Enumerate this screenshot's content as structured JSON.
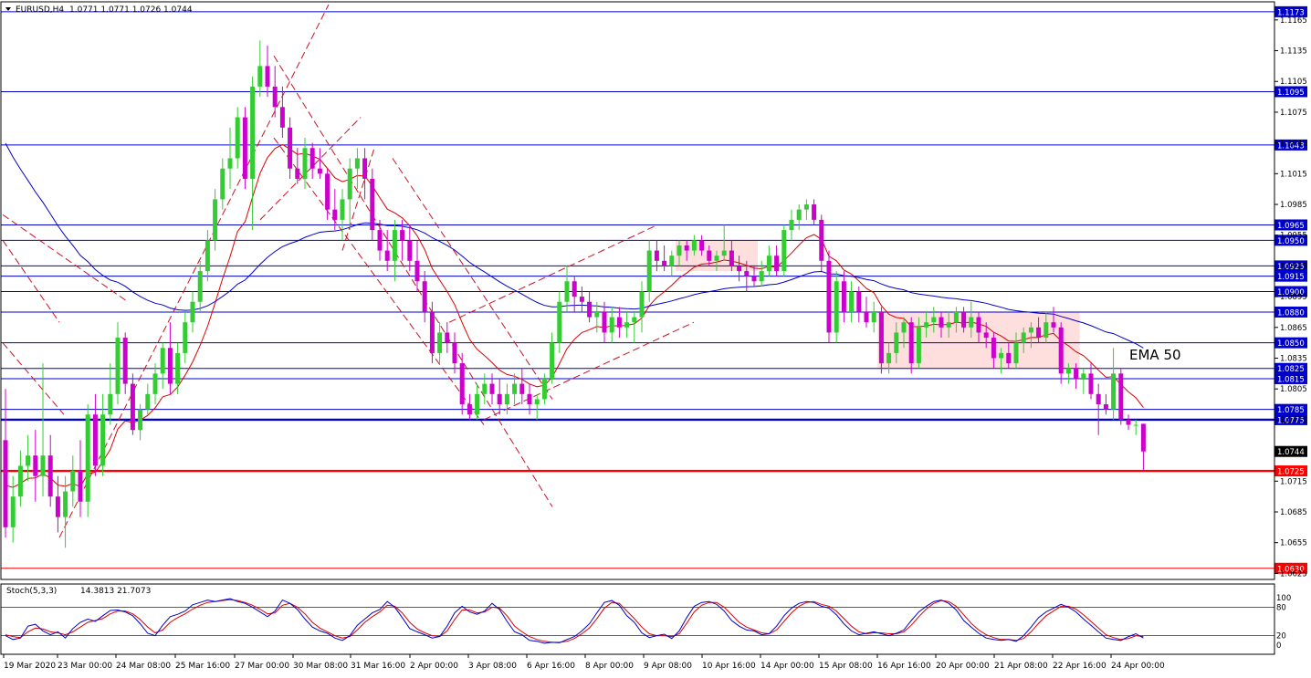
{
  "chart_data": {
    "type": "candlestick",
    "title": "EURUSD,H4",
    "ohlc_header": "1.0771 1.0771 1.0726 1.0744",
    "ylim": [
      1.062,
      1.118
    ],
    "y_ticks": [
      "1.1165",
      "1.1135",
      "1.1105",
      "1.1075",
      "1.1045",
      "1.1015",
      "1.0985",
      "1.0955",
      "1.0925",
      "1.0895",
      "1.0865",
      "1.0835",
      "1.0805",
      "1.0775",
      "1.0745",
      "1.0715",
      "1.0685",
      "1.0655",
      "1.0625"
    ],
    "x_ticks": [
      "19 Mar 2020",
      "23 Mar 00:00",
      "24 Mar 08:00",
      "25 Mar 16:00",
      "27 Mar 00:00",
      "30 Mar 08:00",
      "31 Mar 16:00",
      "2 Apr 00:00",
      "3 Apr 08:00",
      "6 Apr 16:00",
      "8 Apr 00:00",
      "9 Apr 08:00",
      "10 Apr 16:00",
      "14 Apr 00:00",
      "15 Apr 08:00",
      "16 Apr 16:00",
      "20 Apr 00:00",
      "21 Apr 08:00",
      "22 Apr 16:00",
      "24 Apr 00:00"
    ],
    "horizontal_levels": [
      {
        "price": "1.1173",
        "color": "#0000cc"
      },
      {
        "price": "1.1095",
        "color": "#0000cc"
      },
      {
        "price": "1.1043",
        "color": "#0000cc"
      },
      {
        "price": "1.0965",
        "color": "#0000cc"
      },
      {
        "price": "1.0950",
        "color": "#0000cc"
      },
      {
        "price": "1.0925",
        "color": "#0000cc"
      },
      {
        "price": "1.0915",
        "color": "#0000cc"
      },
      {
        "price": "1.0900",
        "color": "#0000cc"
      },
      {
        "price": "1.0880",
        "color": "#0000cc"
      },
      {
        "price": "1.0850",
        "color": "#0000cc"
      },
      {
        "price": "1.0825",
        "color": "#0000cc"
      },
      {
        "price": "1.0815",
        "color": "#0000cc"
      },
      {
        "price": "1.0785",
        "color": "#0000cc"
      },
      {
        "price": "1.0775",
        "color": "#0000cc"
      },
      {
        "price": "1.0725",
        "color": "#ff0000"
      },
      {
        "price": "1.0630",
        "color": "#ff0000"
      }
    ],
    "current_price": "1.0744",
    "annotation": "EMA 50",
    "colors": {
      "bull": "#33cc33",
      "bear": "#cc00cc",
      "ema_fast": "#dd0000",
      "ema_slow": "#0000cc",
      "level_blue": "#0000cc",
      "level_red": "#ff0000",
      "zone": "#ffd6d6"
    },
    "candles": [
      [
        1.0755,
        1.0805,
        1.066,
        1.067
      ],
      [
        1.067,
        1.072,
        1.0655,
        1.07
      ],
      [
        1.07,
        1.0745,
        1.069,
        1.073
      ],
      [
        1.073,
        1.076,
        1.0715,
        1.074
      ],
      [
        1.074,
        1.0765,
        1.0695,
        1.072
      ],
      [
        1.072,
        1.083,
        1.07,
        1.074
      ],
      [
        1.074,
        1.076,
        1.069,
        1.07
      ],
      [
        1.07,
        1.072,
        1.0665,
        1.068
      ],
      [
        1.068,
        1.072,
        1.065,
        1.0705
      ],
      [
        1.0705,
        1.074,
        1.069,
        1.0725
      ],
      [
        1.0725,
        1.0755,
        1.068,
        1.0695
      ],
      [
        1.0695,
        1.079,
        1.068,
        1.078
      ],
      [
        1.078,
        1.08,
        1.072,
        1.073
      ],
      [
        1.073,
        1.08,
        1.072,
        1.078
      ],
      [
        1.078,
        1.083,
        1.077,
        1.08
      ],
      [
        1.08,
        1.087,
        1.079,
        1.0855
      ],
      [
        1.0855,
        1.086,
        1.08,
        1.081
      ],
      [
        1.081,
        1.082,
        1.076,
        1.0765
      ],
      [
        1.0765,
        1.079,
        1.0755,
        1.0785
      ],
      [
        1.0785,
        1.081,
        1.078,
        1.08
      ],
      [
        1.08,
        1.083,
        1.079,
        1.082
      ],
      [
        1.082,
        1.085,
        1.0805,
        1.0845
      ],
      [
        1.0845,
        1.087,
        1.08,
        1.081
      ],
      [
        1.081,
        1.085,
        1.08,
        1.084
      ],
      [
        1.084,
        1.088,
        1.083,
        1.087
      ],
      [
        1.087,
        1.09,
        1.086,
        1.089
      ],
      [
        1.089,
        1.093,
        1.088,
        1.092
      ],
      [
        1.092,
        1.096,
        1.091,
        1.095
      ],
      [
        1.095,
        1.1,
        1.094,
        1.099
      ],
      [
        1.099,
        1.103,
        1.098,
        1.102
      ],
      [
        1.102,
        1.106,
        1.1,
        1.103
      ],
      [
        1.103,
        1.108,
        1.102,
        1.107
      ],
      [
        1.107,
        1.108,
        1.1,
        1.101
      ],
      [
        1.101,
        1.111,
        1.096,
        1.11
      ],
      [
        1.11,
        1.1145,
        1.109,
        1.112
      ],
      [
        1.112,
        1.114,
        1.109,
        1.11
      ],
      [
        1.11,
        1.112,
        1.107,
        1.108
      ],
      [
        1.108,
        1.11,
        1.105,
        1.106
      ],
      [
        1.106,
        1.107,
        1.101,
        1.102
      ],
      [
        1.102,
        1.104,
        1.1005,
        1.101
      ],
      [
        1.101,
        1.105,
        1.1,
        1.104
      ],
      [
        1.104,
        1.1045,
        1.101,
        1.102
      ],
      [
        1.102,
        1.104,
        1.101,
        1.1015
      ],
      [
        1.1015,
        1.102,
        1.097,
        1.098
      ],
      [
        1.098,
        1.1,
        1.096,
        1.097
      ],
      [
        1.097,
        1.1,
        1.095,
        1.099
      ],
      [
        1.099,
        1.103,
        1.096,
        1.102
      ],
      [
        1.102,
        1.104,
        1.1,
        1.103
      ],
      [
        1.103,
        1.104,
        1.099,
        1.101
      ],
      [
        1.101,
        1.102,
        1.095,
        1.096
      ],
      [
        1.096,
        1.097,
        1.093,
        1.094
      ],
      [
        1.094,
        1.096,
        1.092,
        1.093
      ],
      [
        1.093,
        1.097,
        1.091,
        1.096
      ],
      [
        1.096,
        1.097,
        1.093,
        1.095
      ],
      [
        1.095,
        1.0965,
        1.092,
        1.093
      ],
      [
        1.093,
        1.095,
        1.09,
        1.091
      ],
      [
        1.091,
        1.092,
        1.087,
        1.088
      ],
      [
        1.088,
        1.089,
        1.083,
        1.084
      ],
      [
        1.084,
        1.087,
        1.083,
        1.086
      ],
      [
        1.086,
        1.087,
        1.084,
        1.085
      ],
      [
        1.085,
        1.086,
        1.082,
        1.083
      ],
      [
        1.083,
        1.084,
        1.078,
        1.079
      ],
      [
        1.079,
        1.08,
        1.0775,
        1.078
      ],
      [
        1.078,
        1.081,
        1.0775,
        1.08
      ],
      [
        1.08,
        1.082,
        1.079,
        1.081
      ],
      [
        1.081,
        1.082,
        1.079,
        1.08
      ],
      [
        1.08,
        1.0815,
        1.078,
        1.079
      ],
      [
        1.079,
        1.081,
        1.078,
        1.08
      ],
      [
        1.08,
        1.082,
        1.079,
        1.081
      ],
      [
        1.081,
        1.0825,
        1.079,
        1.08
      ],
      [
        1.08,
        1.081,
        1.078,
        1.079
      ],
      [
        1.079,
        1.08,
        1.0775,
        1.0795
      ],
      [
        1.0795,
        1.082,
        1.079,
        1.0815
      ],
      [
        1.0815,
        1.086,
        1.081,
        1.085
      ],
      [
        1.085,
        1.09,
        1.084,
        1.089
      ],
      [
        1.089,
        1.0925,
        1.088,
        1.091
      ],
      [
        1.091,
        1.0915,
        1.088,
        1.0895
      ],
      [
        1.0895,
        1.0905,
        1.088,
        1.089
      ],
      [
        1.089,
        1.09,
        1.087,
        1.0875
      ],
      [
        1.0875,
        1.089,
        1.086,
        1.088
      ],
      [
        1.088,
        1.089,
        1.085,
        1.086
      ],
      [
        1.086,
        1.0885,
        1.085,
        1.0875
      ],
      [
        1.0875,
        1.0885,
        1.0855,
        1.0865
      ],
      [
        1.0865,
        1.088,
        1.0855,
        1.087
      ],
      [
        1.087,
        1.088,
        1.085,
        1.0875
      ],
      [
        1.0875,
        1.091,
        1.086,
        1.09
      ],
      [
        1.09,
        1.095,
        1.089,
        1.094
      ],
      [
        1.094,
        1.095,
        1.092,
        1.093
      ],
      [
        1.093,
        1.0945,
        1.092,
        1.0925
      ],
      [
        1.0925,
        1.094,
        1.0915,
        1.0935
      ],
      [
        1.0935,
        1.095,
        1.0925,
        1.0945
      ],
      [
        1.0945,
        1.095,
        1.093,
        1.094
      ],
      [
        1.094,
        1.0955,
        1.0935,
        1.095
      ],
      [
        1.095,
        1.0955,
        1.0935,
        1.094
      ],
      [
        1.094,
        1.0945,
        1.0925,
        1.093
      ],
      [
        1.093,
        1.094,
        1.092,
        1.0935
      ],
      [
        1.0935,
        1.0965,
        1.093,
        1.094
      ],
      [
        1.094,
        1.095,
        1.092,
        1.0925
      ],
      [
        1.0925,
        1.0935,
        1.091,
        1.092
      ],
      [
        1.092,
        1.093,
        1.09,
        1.0915
      ],
      [
        1.0915,
        1.0925,
        1.0905,
        1.091
      ],
      [
        1.091,
        1.093,
        1.0905,
        1.092
      ],
      [
        1.092,
        1.0945,
        1.0915,
        1.0935
      ],
      [
        1.0935,
        1.0945,
        1.0915,
        1.092
      ],
      [
        1.092,
        1.0965,
        1.0915,
        1.096
      ],
      [
        1.096,
        1.098,
        1.095,
        1.097
      ],
      [
        1.097,
        1.0985,
        1.096,
        1.098
      ],
      [
        1.098,
        1.099,
        1.097,
        1.0985
      ],
      [
        1.0985,
        1.099,
        1.0965,
        1.097
      ],
      [
        1.097,
        1.0975,
        1.092,
        1.093
      ],
      [
        1.093,
        1.094,
        1.085,
        1.086
      ],
      [
        1.086,
        1.092,
        1.085,
        1.091
      ],
      [
        1.091,
        1.092,
        1.087,
        1.088
      ],
      [
        1.088,
        1.091,
        1.087,
        1.09
      ],
      [
        1.09,
        1.0905,
        1.087,
        1.088
      ],
      [
        1.088,
        1.0895,
        1.0865,
        1.087
      ],
      [
        1.087,
        1.089,
        1.086,
        1.088
      ],
      [
        1.088,
        1.0885,
        1.082,
        1.083
      ],
      [
        1.083,
        1.085,
        1.082,
        1.084
      ],
      [
        1.084,
        1.087,
        1.083,
        1.086
      ],
      [
        1.086,
        1.0875,
        1.0845,
        1.087
      ],
      [
        1.087,
        1.0875,
        1.082,
        1.083
      ],
      [
        1.083,
        1.0875,
        1.0825,
        1.0865
      ],
      [
        1.0865,
        1.088,
        1.0855,
        1.087
      ],
      [
        1.087,
        1.0885,
        1.086,
        1.0875
      ],
      [
        1.0875,
        1.088,
        1.0855,
        1.0865
      ],
      [
        1.0865,
        1.088,
        1.0855,
        1.087
      ],
      [
        1.087,
        1.0885,
        1.086,
        1.088
      ],
      [
        1.088,
        1.0885,
        1.086,
        1.0865
      ],
      [
        1.0865,
        1.089,
        1.0855,
        1.0875
      ],
      [
        1.0875,
        1.088,
        1.085,
        1.086
      ],
      [
        1.086,
        1.087,
        1.0845,
        1.0855
      ],
      [
        1.0855,
        1.086,
        1.0825,
        1.0835
      ],
      [
        1.0835,
        1.0845,
        1.082,
        1.084
      ],
      [
        1.084,
        1.085,
        1.0825,
        1.083
      ],
      [
        1.083,
        1.086,
        1.0825,
        1.085
      ],
      [
        1.085,
        1.0865,
        1.084,
        1.086
      ],
      [
        1.086,
        1.087,
        1.0845,
        1.0865
      ],
      [
        1.0865,
        1.0875,
        1.085,
        1.0855
      ],
      [
        1.0855,
        1.088,
        1.085,
        1.087
      ],
      [
        1.087,
        1.0885,
        1.086,
        1.0865
      ],
      [
        1.0865,
        1.087,
        1.081,
        1.082
      ],
      [
        1.082,
        1.083,
        1.081,
        1.0825
      ],
      [
        1.0825,
        1.083,
        1.0805,
        1.0815
      ],
      [
        1.0815,
        1.0825,
        1.08,
        1.082
      ],
      [
        1.082,
        1.083,
        1.0795,
        1.08
      ],
      [
        1.08,
        1.081,
        1.076,
        1.079
      ],
      [
        1.079,
        1.08,
        1.078,
        1.0785
      ],
      [
        1.0785,
        1.0845,
        1.0775,
        1.082
      ],
      [
        1.082,
        1.0825,
        1.077,
        1.0775
      ],
      [
        1.0775,
        1.078,
        1.0765,
        1.077
      ],
      [
        1.077,
        1.0775,
        1.076,
        1.077
      ],
      [
        1.0771,
        1.0771,
        1.0726,
        1.0744
      ]
    ],
    "stoch": {
      "name": "Stoch(5,3,3)",
      "values_header": "14.3813 21.7073",
      "levels": [
        80,
        20
      ],
      "ylim": [
        0,
        100
      ],
      "y_ticks": [
        "100",
        "80",
        "20",
        "0"
      ],
      "main": [
        20,
        12,
        15,
        40,
        44,
        30,
        22,
        28,
        15,
        35,
        48,
        55,
        50,
        62,
        73,
        74,
        70,
        62,
        45,
        25,
        20,
        42,
        60,
        65,
        72,
        85,
        90,
        95,
        92,
        95,
        98,
        92,
        88,
        80,
        70,
        60,
        72,
        95,
        88,
        75,
        55,
        38,
        30,
        25,
        15,
        10,
        20,
        42,
        55,
        68,
        75,
        92,
        80,
        58,
        35,
        28,
        22,
        15,
        18,
        40,
        68,
        82,
        70,
        65,
        72,
        88,
        75,
        50,
        28,
        22,
        10,
        8,
        4,
        6,
        5,
        12,
        18,
        30,
        45,
        68,
        90,
        94,
        84,
        62,
        48,
        26,
        16,
        20,
        23,
        14,
        30,
        58,
        82,
        90,
        92,
        86,
        72,
        52,
        40,
        32,
        30,
        22,
        24,
        40,
        62,
        78,
        88,
        92,
        90,
        82,
        78,
        64,
        45,
        30,
        22,
        25,
        28,
        24,
        20,
        25,
        32,
        52,
        70,
        82,
        92,
        95,
        88,
        74,
        52,
        38,
        25,
        15,
        12,
        10,
        12,
        8,
        20,
        38,
        58,
        70,
        78,
        86,
        80,
        70,
        55,
        42,
        28,
        15,
        12,
        10,
        18,
        24,
        15
      ],
      "signal": [
        22,
        18,
        16,
        28,
        36,
        34,
        28,
        26,
        22,
        28,
        38,
        48,
        52,
        56,
        66,
        72,
        72,
        66,
        54,
        38,
        26,
        32,
        48,
        58,
        66,
        76,
        84,
        90,
        92,
        94,
        96,
        94,
        90,
        84,
        76,
        66,
        68,
        84,
        88,
        80,
        66,
        48,
        36,
        28,
        20,
        15,
        18,
        32,
        48,
        60,
        70,
        84,
        82,
        68,
        48,
        34,
        26,
        20,
        18,
        30,
        54,
        74,
        74,
        68,
        70,
        80,
        78,
        62,
        40,
        28,
        18,
        12,
        8,
        6,
        6,
        8,
        14,
        24,
        36,
        56,
        78,
        90,
        88,
        72,
        56,
        38,
        24,
        20,
        20,
        18,
        24,
        46,
        70,
        84,
        90,
        90,
        80,
        64,
        48,
        38,
        32,
        26,
        24,
        32,
        50,
        68,
        82,
        90,
        92,
        86,
        82,
        72,
        56,
        40,
        28,
        24,
        26,
        26,
        24,
        24,
        28,
        42,
        60,
        76,
        88,
        94,
        92,
        82,
        64,
        46,
        32,
        22,
        16,
        12,
        12,
        10,
        14,
        28,
        46,
        62,
        72,
        82,
        82,
        76,
        64,
        50,
        36,
        22,
        16,
        12,
        14,
        20,
        18
      ]
    }
  }
}
